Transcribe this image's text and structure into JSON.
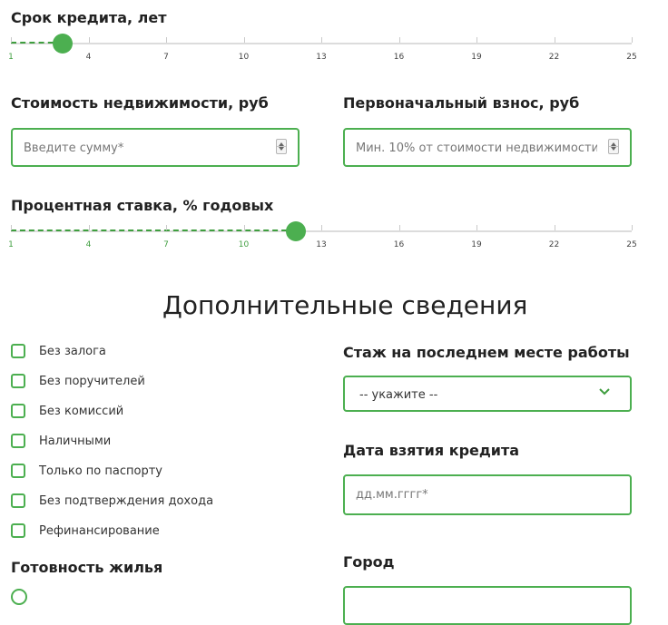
{
  "term": {
    "label": "Срок кредита, лет",
    "ticks": [
      "1",
      "4",
      "7",
      "10",
      "13",
      "16",
      "19",
      "22",
      "25"
    ],
    "min": 1,
    "max": 25,
    "value": 3
  },
  "price": {
    "label": "Стоимость недвижимости, руб",
    "placeholder": "Введите сумму*"
  },
  "downpayment": {
    "label": "Первоначальный взнос, руб",
    "placeholder": "Мин. 10% от стоимости недвижимости*"
  },
  "rate": {
    "label": "Процентная ставка, % годовых",
    "ticks": [
      "1",
      "4",
      "7",
      "10",
      "13",
      "16",
      "19",
      "22",
      "25"
    ],
    "min": 1,
    "max": 25,
    "value": 12
  },
  "extra": {
    "title": "Дополнительные сведения",
    "options": [
      "Без залога",
      "Без поручителей",
      "Без комиссий",
      "Наличными",
      "Только по паспорту",
      "Без подтверждения дохода",
      "Рефинансирование"
    ]
  },
  "readiness": {
    "label": "Готовность жилья"
  },
  "experience": {
    "label": "Стаж на последнем месте работы",
    "selected": "-- укажите --"
  },
  "date": {
    "label": "Дата взятия кредита",
    "placeholder": "дд.мм.гггг*"
  },
  "city": {
    "label": "Город"
  },
  "colors": {
    "accent": "#4caf50",
    "active_tick": "#3f9e3f"
  }
}
